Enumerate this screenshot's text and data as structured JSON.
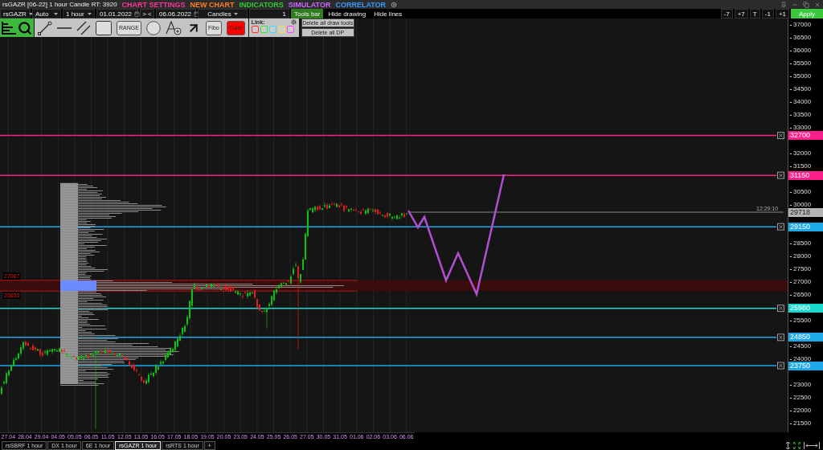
{
  "title_bar": {
    "title": "rsGAZR [06-22] 1 hour Candle RT: 3920",
    "menu": [
      {
        "label": "CHART SETTINGS",
        "color": "#ff3399"
      },
      {
        "label": "NEW CHART",
        "color": "#ff7f1f"
      },
      {
        "label": "INDICATORS",
        "color": "#33cc33"
      },
      {
        "label": "SIMULATOR",
        "color": "#cc66ff"
      },
      {
        "label": "CORRELATOR",
        "color": "#3399ff"
      }
    ]
  },
  "toolbar": {
    "symbol": "rsGAZR",
    "scale": "Auto",
    "timeframe": "1 hour",
    "date_from": "01.01.2022",
    "range_button": "> <",
    "date_to": "06.06.2022",
    "chart_type": "Candles",
    "count": "1",
    "buttons": [
      {
        "label": "Tools bar",
        "selected": true
      },
      {
        "label": "Hide drawing",
        "selected": false
      },
      {
        "label": "Hide lines",
        "selected": false
      }
    ],
    "shift_buttons": [
      "-7",
      "+7",
      "T",
      "-1",
      "+1"
    ],
    "apply": "Apply"
  },
  "tools_palette": {
    "range_label": "RANGE",
    "fibo_label": "Fibo",
    "color_label": "Color",
    "link_label": "Link:",
    "link_colors": [
      {
        "color": "#ff3030"
      },
      {
        "color": "#40e040"
      },
      {
        "color": "#30e0f0"
      },
      {
        "color": "#f0e040"
      },
      {
        "color": "#ff40ff"
      }
    ],
    "delete_buttons": [
      "Delete all draw tools",
      "Delete all DP"
    ]
  },
  "chart": {
    "price_ticks": [
      "37000",
      "36500",
      "36000",
      "35500",
      "35000",
      "34500",
      "34000",
      "33500",
      "33000",
      "32000",
      "31500",
      "30500",
      "30000",
      "28500",
      "28000",
      "27500",
      "27000",
      "26500",
      "25500",
      "24500",
      "24000",
      "23000",
      "22500",
      "22000",
      "21500"
    ],
    "levels": [
      {
        "price": "32700",
        "color": "#ff1f8a"
      },
      {
        "price": "31150",
        "color": "#ff1f8a"
      },
      {
        "price": "29150",
        "color": "#1ea8e8"
      },
      {
        "price": "25980",
        "color": "#19d8d0"
      },
      {
        "price": "24850",
        "color": "#1ea8e8"
      },
      {
        "price": "23750",
        "color": "#1ea8e8"
      }
    ],
    "current_price": {
      "value": "29718",
      "time": "12:29:10"
    },
    "zone": {
      "upper": "27067",
      "lower": "26650"
    },
    "dates": [
      "27.04",
      "28.04",
      "29.04",
      "04.05",
      "05.05",
      "06.05",
      "11.05",
      "12.05",
      "13.05",
      "16.05",
      "17.05",
      "18.05",
      "19.05",
      "20.05",
      "23.05",
      "24.05",
      "25.05",
      "26.05",
      "27.05",
      "30.05",
      "31.05",
      "01.06",
      "02.06",
      "03.06",
      "06.06"
    ]
  },
  "tabs": [
    {
      "label": "rsSBRF 1 hour",
      "selected": false
    },
    {
      "label": "DX 1 hour",
      "selected": false
    },
    {
      "label": "6E 1 hour",
      "selected": false
    },
    {
      "label": "rsGAZR 1 hour",
      "selected": true
    },
    {
      "label": "rsRTS 1 hour",
      "selected": false
    },
    {
      "label": "+",
      "selected": false
    }
  ]
}
